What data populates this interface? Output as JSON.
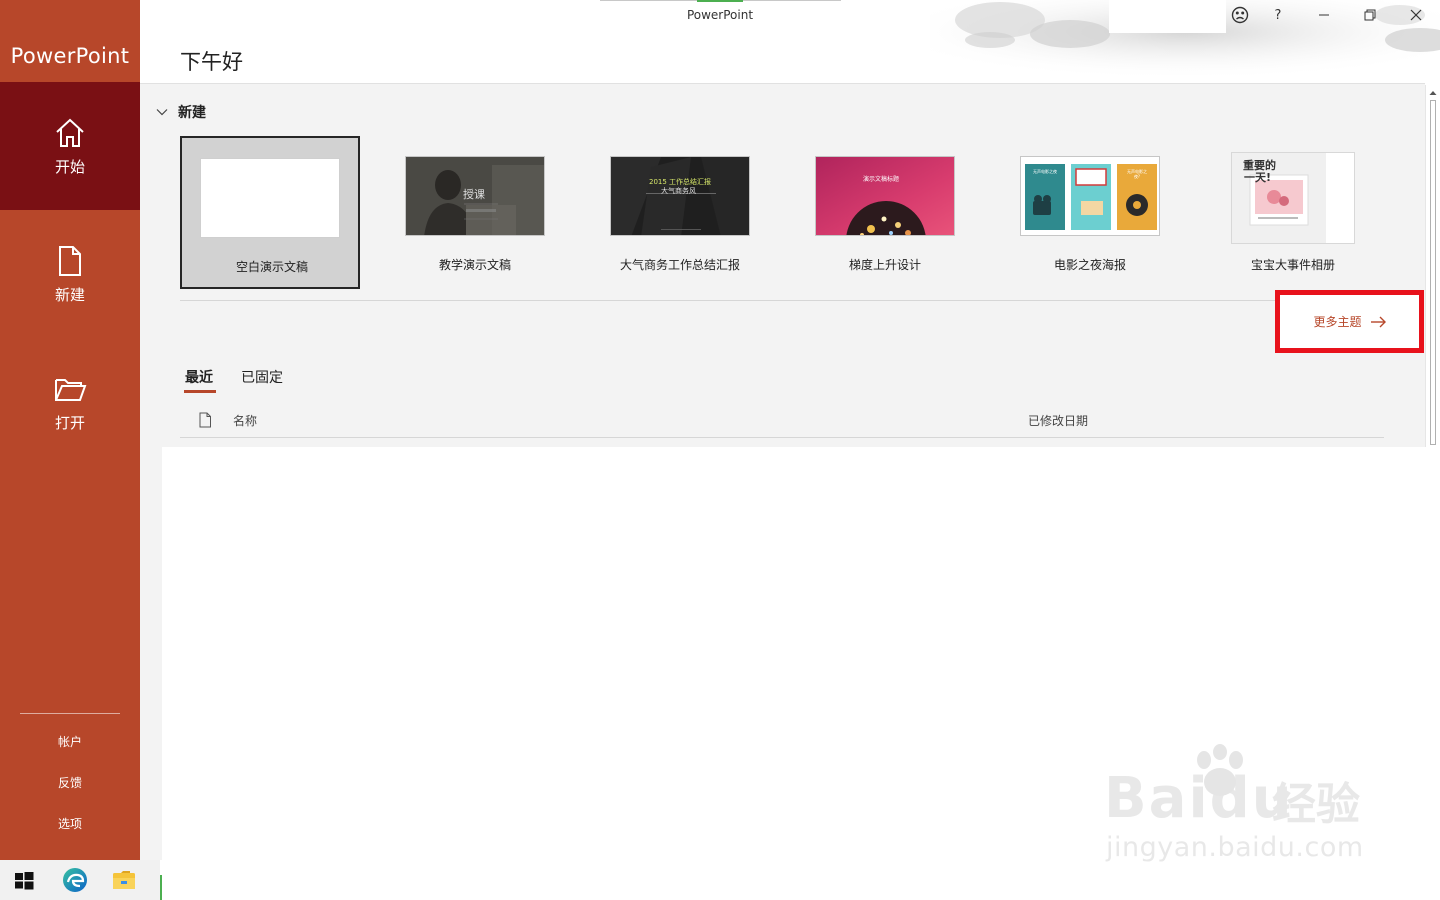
{
  "app": {
    "title": "PowerPoint",
    "brand": "PowerPoint",
    "greeting": "下午好"
  },
  "sidebar": {
    "nav": [
      {
        "label": "开始",
        "icon": "home-icon",
        "active": true
      },
      {
        "label": "新建",
        "icon": "new-file-icon",
        "active": false
      },
      {
        "label": "打开",
        "icon": "open-folder-icon",
        "active": false
      }
    ],
    "bottom": [
      "帐户",
      "反馈",
      "选项"
    ]
  },
  "new_section": {
    "label": "新建",
    "templates": [
      {
        "label": "空白演示文稿",
        "selected": true
      },
      {
        "label": "教学演示文稿",
        "thumb_text": "授课"
      },
      {
        "label": "大气商务工作总结汇报",
        "thumb_text_1": "2015 工作总结汇报",
        "thumb_text_2": "大气商务风"
      },
      {
        "label": "梯度上升设计",
        "thumb_text": "演示文稿标题"
      },
      {
        "label": "电影之夜海报",
        "thumb_text_1": "无声电影之夜",
        "thumb_text_2": "无声电影之夜?"
      },
      {
        "label": "宝宝大事件相册",
        "thumb_text_1": "重要的",
        "thumb_text_2": "一天!"
      }
    ],
    "more_themes": "更多主题"
  },
  "recent": {
    "tabs": [
      {
        "label": "最近",
        "active": true
      },
      {
        "label": "已固定",
        "active": false
      }
    ],
    "columns": {
      "name": "名称",
      "modified": "已修改日期"
    }
  },
  "watermark": {
    "brand": "Baidu",
    "cn": "经验",
    "url": "jingyan.baidu.com"
  },
  "colors": {
    "accent": "#b7472a",
    "active_nav": "#7a1014",
    "highlight": "#e8121c"
  }
}
